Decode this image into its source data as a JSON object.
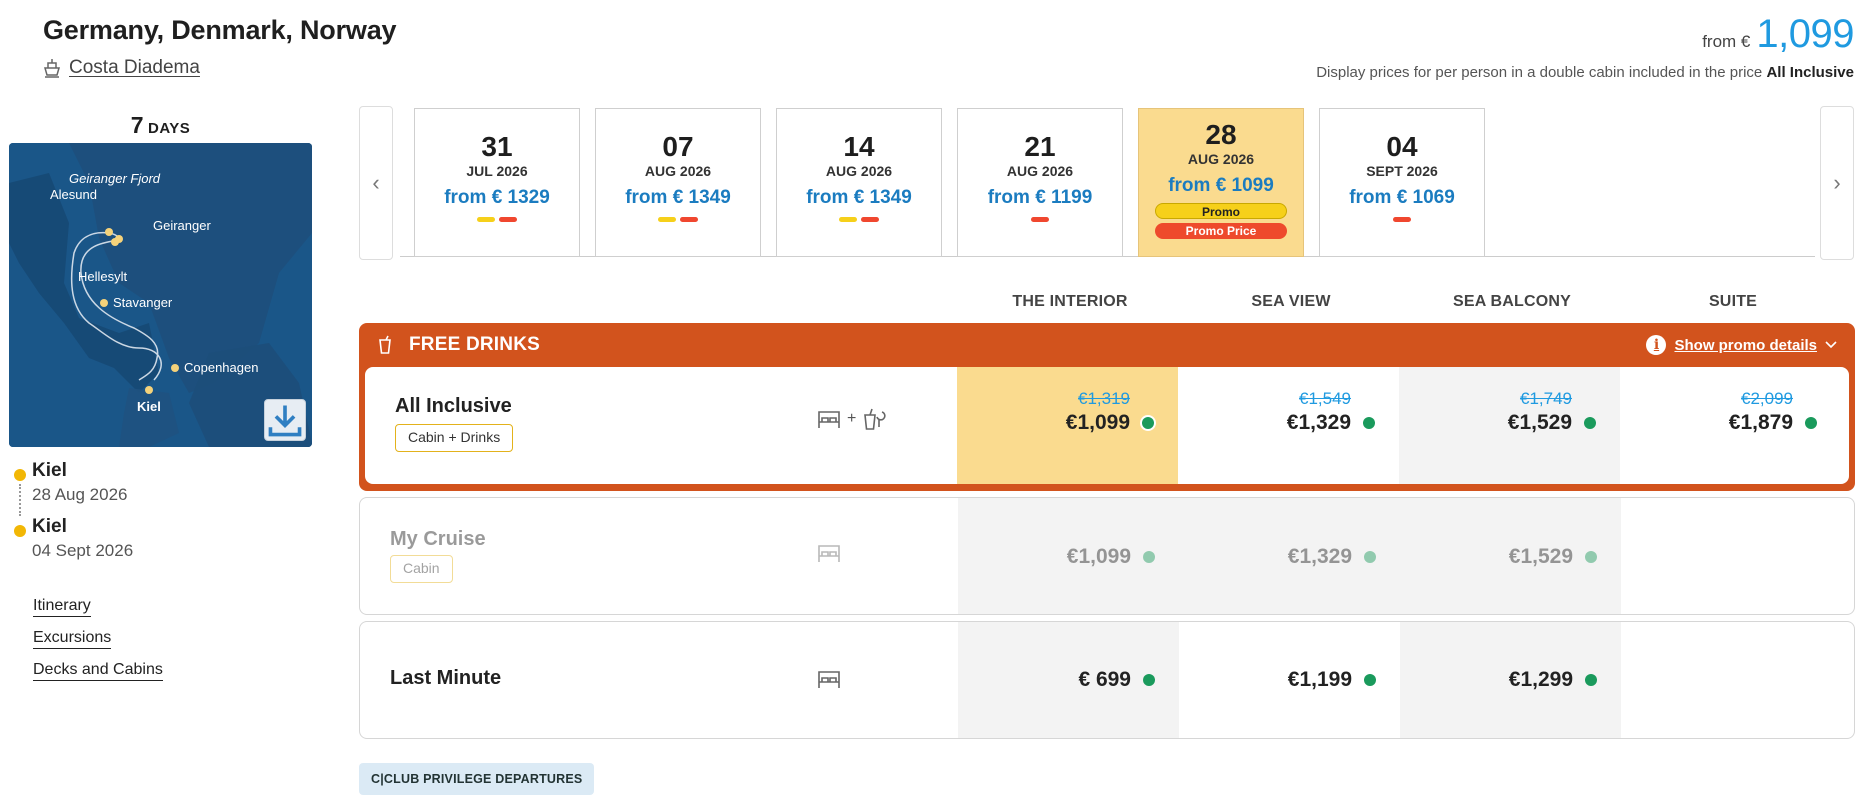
{
  "header": {
    "title": "Germany, Denmark, Norway",
    "ship_name": "Costa Diadema",
    "price_from_label": "from €",
    "price_from_amount": "1,099",
    "price_note": "Display prices for per person in a double cabin included in the price",
    "price_note_bold": "All Inclusive"
  },
  "trip": {
    "days_number": "7",
    "days_label": "DAYS",
    "map_labels": [
      "Geiranger Fjord",
      "Alesund",
      "Geiranger",
      "Hellesylt",
      "Stavanger",
      "Copenhagen",
      "Kiel"
    ],
    "departure": {
      "port": "Kiel",
      "date": "28 Aug 2026"
    },
    "arrival": {
      "port": "Kiel",
      "date": "04 Sept 2026"
    }
  },
  "side_links": [
    "Itinerary",
    "Excursions",
    "Decks and Cabins"
  ],
  "dates": [
    {
      "day": "31",
      "month": "JUL 2026",
      "from": "from € 1329",
      "marks": [
        "yellow",
        "red"
      ]
    },
    {
      "day": "07",
      "month": "AUG 2026",
      "from": "from € 1349",
      "marks": [
        "yellow",
        "red"
      ]
    },
    {
      "day": "14",
      "month": "AUG 2026",
      "from": "from € 1349",
      "marks": [
        "yellow",
        "red"
      ]
    },
    {
      "day": "21",
      "month": "AUG 2026",
      "from": "from € 1199",
      "marks": [
        "red"
      ]
    },
    {
      "day": "28",
      "month": "AUG 2026",
      "from": "from € 1099",
      "badges": [
        "Promo",
        "Promo Price"
      ],
      "selected": true
    },
    {
      "day": "04",
      "month": "SEPT 2026",
      "from": "from € 1069",
      "marks": [
        "red"
      ]
    }
  ],
  "cabin_columns": [
    "THE INTERIOR",
    "SEA VIEW",
    "SEA BALCONY",
    "SUITE"
  ],
  "promo": {
    "title": "FREE DRINKS",
    "details_label": "Show promo details"
  },
  "fares": [
    {
      "name": "All Inclusive",
      "tag": "Cabin + Drinks",
      "icons_plus": "+",
      "prices": [
        {
          "old": "€1,319",
          "now": "€1,099"
        },
        {
          "old": "€1,549",
          "now": "€1,329"
        },
        {
          "old": "€1,749",
          "now": "€1,529"
        },
        {
          "old": "€2,099",
          "now": "€1,879"
        }
      ]
    },
    {
      "name": "My Cruise",
      "tag": "Cabin",
      "prices": [
        {
          "now": "€1,099"
        },
        {
          "now": "€1,329"
        },
        {
          "now": "€1,529"
        }
      ]
    },
    {
      "name": "Last Minute",
      "prices": [
        {
          "now": "€ 699"
        },
        {
          "now": "€1,199"
        },
        {
          "now": "€1,299"
        }
      ]
    }
  ],
  "club_button": "C|CLUB PRIVILEGE DEPARTURES",
  "colors": {
    "accent_blue": "#1f9ae0",
    "promo_orange": "#d2531d",
    "selected_yellow": "#fadb8f",
    "availability_green": "#1a9a5c"
  }
}
